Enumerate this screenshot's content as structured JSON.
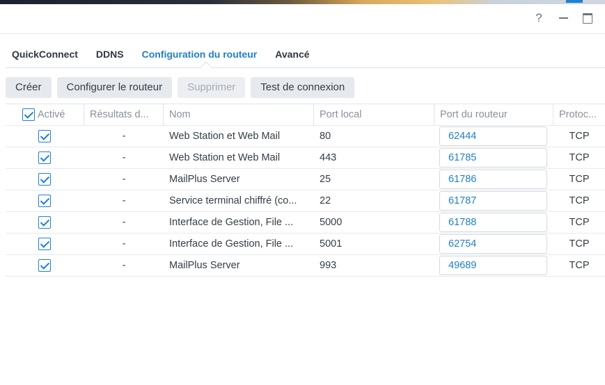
{
  "window": {
    "help_label": "?"
  },
  "tabs": [
    {
      "label": "QuickConnect",
      "active": false
    },
    {
      "label": "DDNS",
      "active": false
    },
    {
      "label": "Configuration du routeur",
      "active": true
    },
    {
      "label": "Avancé",
      "active": false
    }
  ],
  "toolbar": {
    "create": "Créer",
    "configure": "Configurer le routeur",
    "delete": "Supprimer",
    "test": "Test de connexion"
  },
  "table": {
    "columns": {
      "active": "Activé",
      "result": "Résultats d...",
      "name": "Nom",
      "local_port": "Port local",
      "router_port": "Port du routeur",
      "protocol": "Protoc..."
    },
    "rows": [
      {
        "active": true,
        "result": "-",
        "name": "Web Station et Web Mail",
        "local_port": "80",
        "router_port": "62444",
        "protocol": "TCP"
      },
      {
        "active": true,
        "result": "-",
        "name": "Web Station et Web Mail",
        "local_port": "443",
        "router_port": "61785",
        "protocol": "TCP"
      },
      {
        "active": true,
        "result": "-",
        "name": "MailPlus Server",
        "local_port": "25",
        "router_port": "61786",
        "protocol": "TCP"
      },
      {
        "active": true,
        "result": "-",
        "name": "Service terminal chiffré (co...",
        "local_port": "22",
        "router_port": "61787",
        "protocol": "TCP"
      },
      {
        "active": true,
        "result": "-",
        "name": "Interface de Gestion, File ...",
        "local_port": "5000",
        "router_port": "61788",
        "protocol": "TCP"
      },
      {
        "active": true,
        "result": "-",
        "name": "Interface de Gestion, File ...",
        "local_port": "5001",
        "router_port": "62754",
        "protocol": "TCP"
      },
      {
        "active": true,
        "result": "-",
        "name": "MailPlus Server",
        "local_port": "993",
        "router_port": "49689",
        "protocol": "TCP"
      }
    ]
  },
  "colors": {
    "accent": "#1f7fc7",
    "checkbox": "#1d7fd6"
  }
}
